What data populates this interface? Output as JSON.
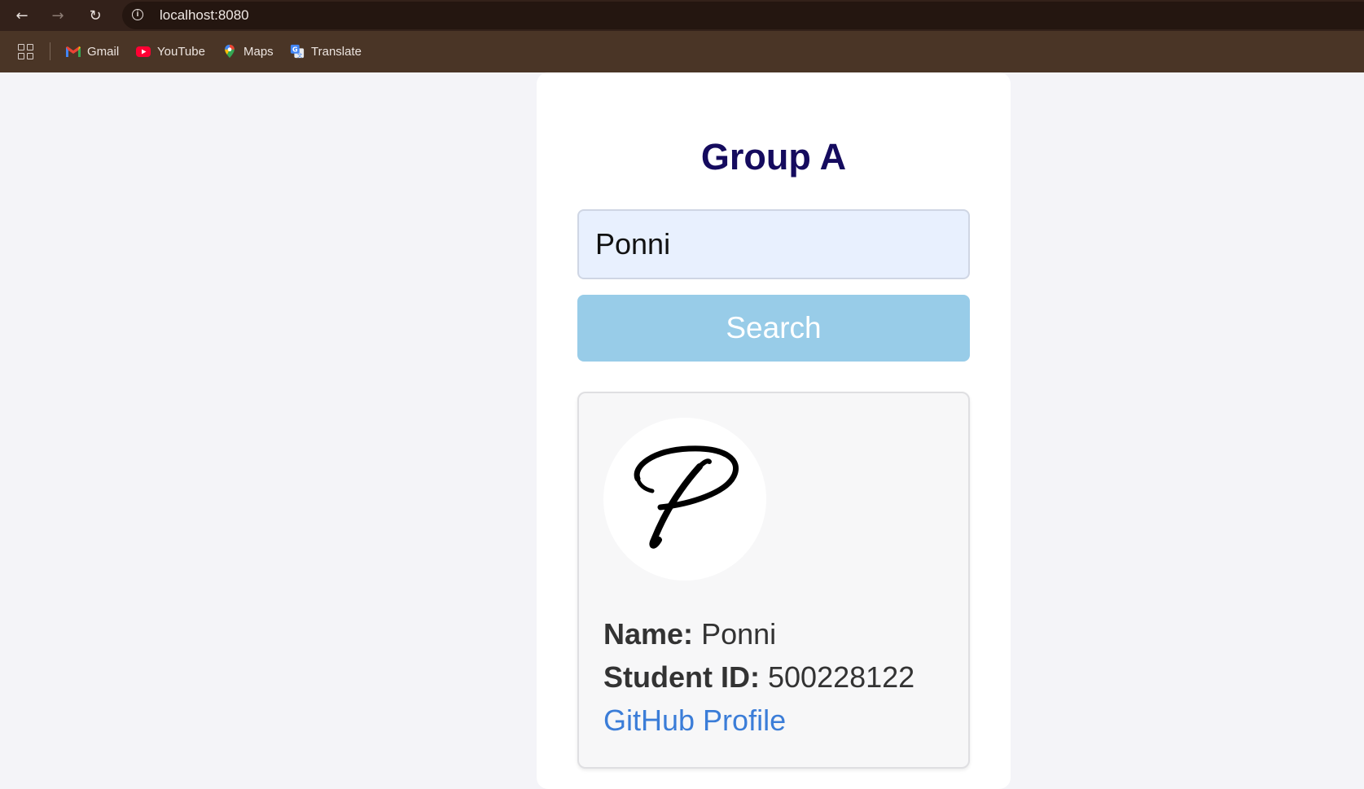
{
  "browser": {
    "url": "localhost:8080",
    "nav": {
      "back_icon": "arrow-left-icon",
      "forward_icon": "arrow-right-icon",
      "reload_icon": "reload-icon"
    },
    "bookmarks": [
      {
        "label": "Gmail",
        "icon": "gmail-icon"
      },
      {
        "label": "YouTube",
        "icon": "youtube-icon"
      },
      {
        "label": "Maps",
        "icon": "maps-icon"
      },
      {
        "label": "Translate",
        "icon": "translate-icon"
      }
    ]
  },
  "app": {
    "title": "Group A",
    "search": {
      "value": "Ponni",
      "button_label": "Search"
    },
    "result": {
      "avatar_icon": "signature-p-avatar",
      "name_label": "Name:",
      "name_value": "Ponni",
      "id_label": "Student ID:",
      "id_value": "500228122",
      "link_label": "GitHub Profile"
    }
  },
  "colors": {
    "title": "#150b5e",
    "button": "#98cce8",
    "link": "#3b7dd8",
    "input_bg": "#e8f0fe"
  }
}
